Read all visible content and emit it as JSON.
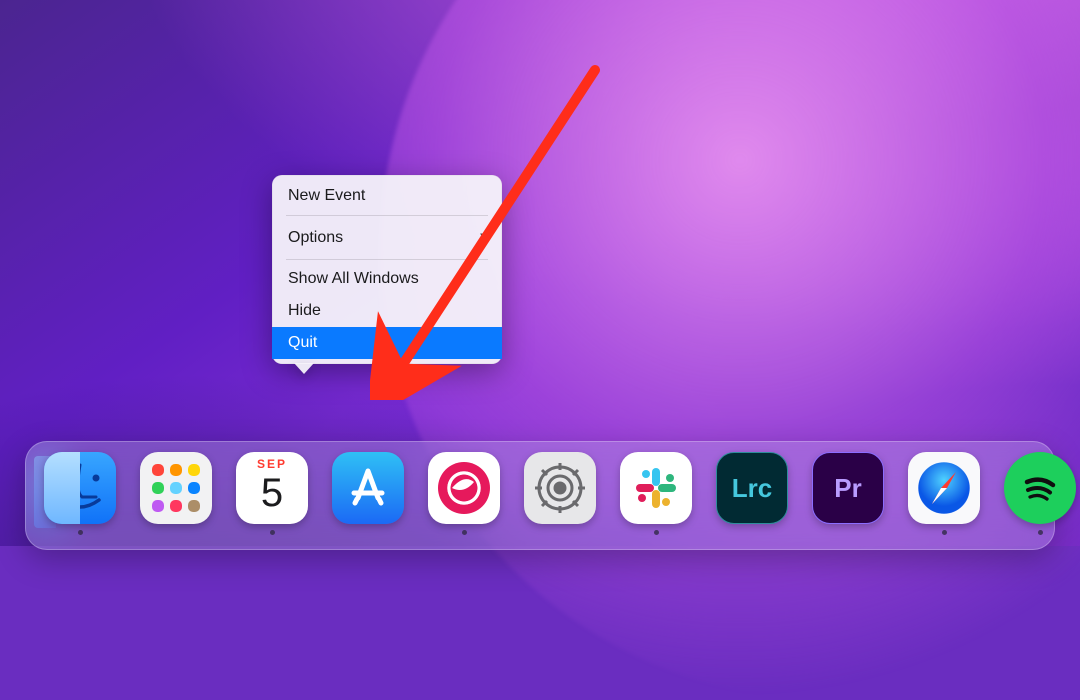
{
  "context_menu": {
    "items": [
      {
        "label": "New Event",
        "has_submenu": false
      },
      {
        "label": "Options",
        "has_submenu": true
      },
      {
        "label": "Show All Windows",
        "has_submenu": false
      },
      {
        "label": "Hide",
        "has_submenu": false
      },
      {
        "label": "Quit",
        "has_submenu": false,
        "highlighted": true
      }
    ]
  },
  "calendar_icon": {
    "month_label": "SEP",
    "day": "5"
  },
  "adobe": {
    "lrc": "Lrc",
    "pr": "Pr"
  },
  "dock": [
    {
      "name": "finder",
      "running": true
    },
    {
      "name": "launchpad",
      "running": false
    },
    {
      "name": "calendar",
      "running": true
    },
    {
      "name": "app-store",
      "running": false
    },
    {
      "name": "skitch",
      "running": true
    },
    {
      "name": "system-settings",
      "running": false
    },
    {
      "name": "slack",
      "running": true
    },
    {
      "name": "lightroom-classic",
      "running": false
    },
    {
      "name": "premiere-pro",
      "running": false
    },
    {
      "name": "safari",
      "running": true
    },
    {
      "name": "spotify",
      "running": true
    }
  ]
}
